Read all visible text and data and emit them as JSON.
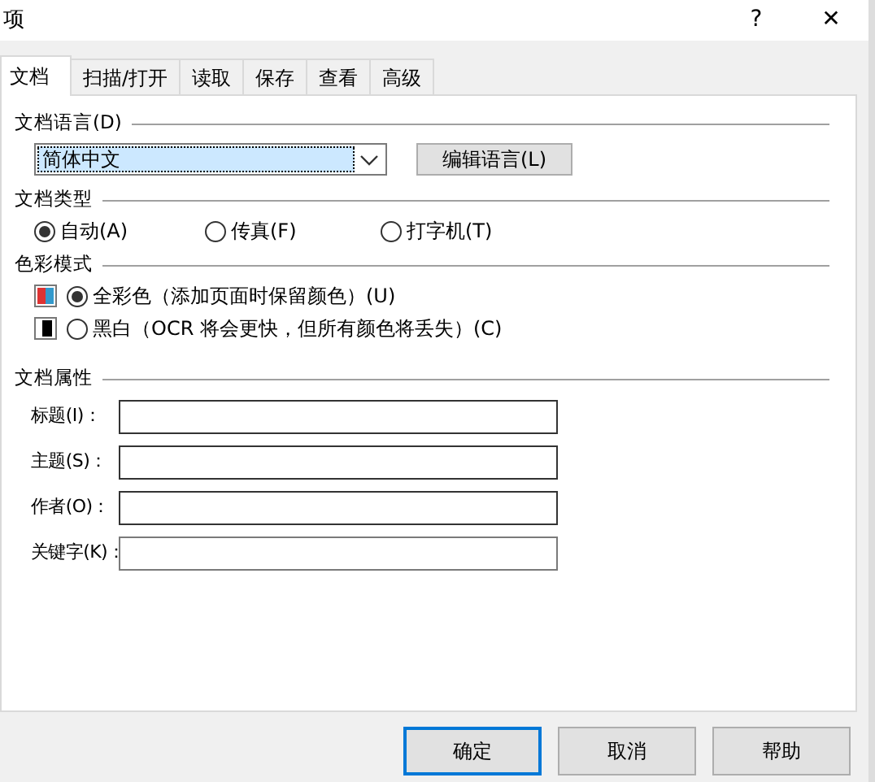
{
  "window": {
    "title": "项",
    "help": "?",
    "close": "✕"
  },
  "tabs": [
    {
      "label": "文档",
      "selected": true
    },
    {
      "label": "扫描/打开",
      "selected": false
    },
    {
      "label": "读取",
      "selected": false
    },
    {
      "label": "保存",
      "selected": false
    },
    {
      "label": "查看",
      "selected": false
    },
    {
      "label": "高级",
      "selected": false
    }
  ],
  "language": {
    "heading": "文档语言(D)",
    "value": "简体中文",
    "button": "编辑语言(L)"
  },
  "doc_type": {
    "heading": "文档类型",
    "options": [
      {
        "label": "自动(A)",
        "selected": true
      },
      {
        "label": "传真(F)",
        "selected": false
      },
      {
        "label": "打字机(T)",
        "selected": false
      }
    ]
  },
  "color_mode": {
    "heading": "色彩模式",
    "options": [
      {
        "label": "全彩色（添加页面时保留颜色）(U)",
        "selected": true,
        "kind": "color"
      },
      {
        "label": "黑白（OCR 将会更快，但所有颜色将丢失）(C)",
        "selected": false,
        "kind": "mono"
      }
    ]
  },
  "properties": {
    "heading": "文档属性",
    "fields": [
      {
        "label": "标题(I)：",
        "disabled": false
      },
      {
        "label": "主题(S)：",
        "disabled": false
      },
      {
        "label": "作者(O)：",
        "disabled": false
      },
      {
        "label": "关键字(K)：",
        "disabled": true
      }
    ]
  },
  "buttons": [
    {
      "label": "确定",
      "default": true
    },
    {
      "label": "取消",
      "default": false
    },
    {
      "label": "帮助",
      "default": false
    }
  ]
}
